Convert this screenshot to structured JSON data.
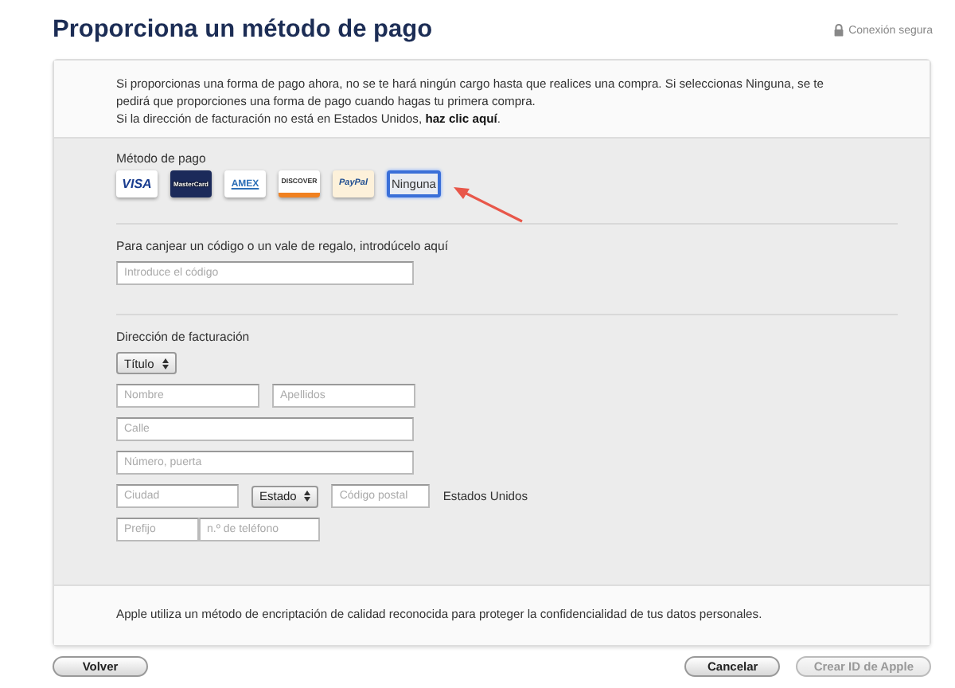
{
  "header": {
    "title": "Proporciona un método de pago",
    "secure": "Conexión segura"
  },
  "notice": {
    "paragraph": "Si proporcionas una forma de pago ahora, no se te hará ningún cargo hasta que realices una compra. Si seleccionas Ninguna, se te pedirá que proporciones una forma de pago cuando hagas tu primera compra.",
    "address_text": "Si la dirección de facturación no está en Estados Unidos,",
    "address_link": "haz clic aquí",
    "address_end": "."
  },
  "payment": {
    "label": "Método de pago",
    "methods": [
      {
        "kind": "visa",
        "label": "VISA",
        "selected": false
      },
      {
        "kind": "mastercard",
        "label": "MasterCard",
        "selected": false
      },
      {
        "kind": "amex",
        "label": "AMEX",
        "selected": false
      },
      {
        "kind": "discover",
        "label": "DISCOVER",
        "selected": false
      },
      {
        "kind": "paypal",
        "label": "PayPal",
        "selected": false
      },
      {
        "kind": "none",
        "label": "Ninguna",
        "selected": true
      }
    ]
  },
  "gift": {
    "label": "Para canjear un código o un vale de regalo, introdúcelo aquí",
    "placeholder": "Introduce el código"
  },
  "billing": {
    "label": "Dirección de facturación",
    "rows": [
      [
        {
          "kind": "select",
          "value": "Título"
        }
      ],
      [
        {
          "kind": "input",
          "placeholder": "Nombre"
        },
        {
          "kind": "input",
          "placeholder": "Apellidos"
        }
      ],
      [
        {
          "kind": "input",
          "placeholder": "Calle"
        }
      ],
      [
        {
          "kind": "input",
          "placeholder": "Número, puerta"
        }
      ],
      [
        {
          "kind": "input",
          "placeholder": "Ciudad"
        },
        {
          "kind": "select",
          "value": "Estado"
        },
        {
          "kind": "input",
          "placeholder": "Código postal"
        },
        {
          "kind": "text",
          "value": "Estados Unidos"
        }
      ],
      [
        {
          "kind": "input",
          "placeholder": "Prefijo"
        },
        {
          "kind": "input",
          "placeholder": "n.º de teléfono",
          "joined": true
        }
      ]
    ]
  },
  "footer_note": "Apple utiliza un método de encriptación de calidad reconocida para proteger la confidencialidad de tus datos personales.",
  "buttons": [
    {
      "label": "Volver",
      "disabled": false
    },
    {
      "label": "Cancelar",
      "disabled": false
    },
    {
      "label": "Crear ID de Apple",
      "disabled": true
    }
  ]
}
